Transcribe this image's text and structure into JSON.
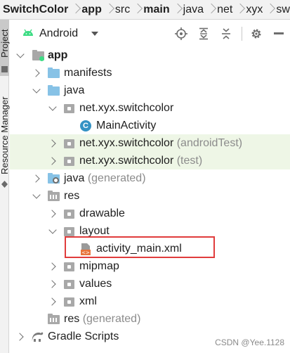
{
  "breadcrumb": {
    "items": [
      "SwitchColor",
      "app",
      "src",
      "main",
      "java",
      "net",
      "xyx",
      "sw"
    ]
  },
  "sidebar": {
    "project_label": "Project",
    "resource_manager_label": "Resource Manager"
  },
  "toolbar": {
    "view_label": "Android",
    "buttons": [
      "locate-icon",
      "expand-all-icon",
      "collapse-all-icon",
      "settings-icon",
      "hide-icon"
    ]
  },
  "tree": {
    "app": "app",
    "manifests": "manifests",
    "java": "java",
    "pkg_main": "net.xyx.switchcolor",
    "main_activity": "MainActivity",
    "pkg_android_test": "net.xyx.switchcolor",
    "pkg_android_test_suffix": "(androidTest)",
    "pkg_test": "net.xyx.switchcolor",
    "pkg_test_suffix": "(test)",
    "java_generated": "java",
    "java_generated_suffix": "(generated)",
    "res": "res",
    "drawable": "drawable",
    "layout": "layout",
    "activity_main": "activity_main.xml",
    "mipmap": "mipmap",
    "values": "values",
    "xml": "xml",
    "res_generated": "res",
    "res_generated_suffix": "(generated)",
    "gradle_scripts": "Gradle Scripts"
  },
  "colors": {
    "highlight_box": "#e03c3c",
    "android_green": "#3ddc84",
    "class_icon": "#3592c4",
    "folder_blue": "#87c2e6",
    "test_row_tint": "#eef6e6"
  },
  "watermark": "CSDN @Yee.1128"
}
